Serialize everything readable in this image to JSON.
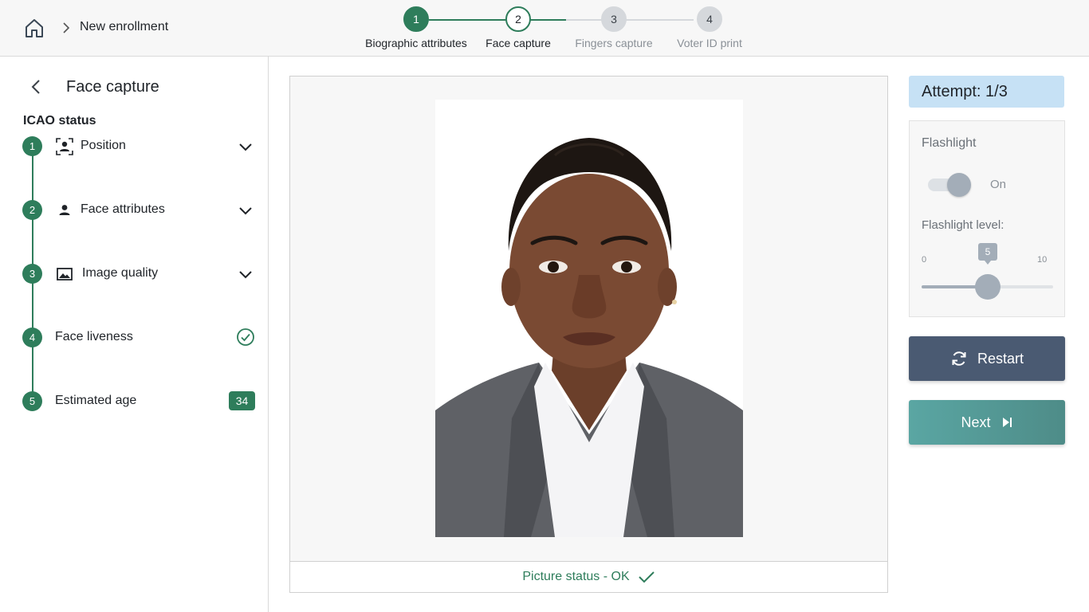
{
  "header": {
    "breadcrumb_title": "New enrollment",
    "steps": [
      {
        "number": "1",
        "label": "Biographic attributes",
        "state": "done"
      },
      {
        "number": "2",
        "label": "Face capture",
        "state": "active"
      },
      {
        "number": "3",
        "label": "Fingers capture",
        "state": "future"
      },
      {
        "number": "4",
        "label": "Voter ID print",
        "state": "future"
      }
    ]
  },
  "sidebar": {
    "title": "Face capture",
    "icao_label": "ICAO status",
    "items": [
      {
        "number": "1",
        "label": "Position",
        "icon": "person-frame-icon",
        "trailing": "chevron-down-icon"
      },
      {
        "number": "2",
        "label": "Face attributes",
        "icon": "person-icon",
        "trailing": "chevron-down-icon"
      },
      {
        "number": "3",
        "label": "Image quality",
        "icon": "image-icon",
        "trailing": "chevron-down-icon"
      },
      {
        "number": "4",
        "label": "Face liveness",
        "icon": "",
        "trailing": "check-circle-icon"
      },
      {
        "number": "5",
        "label": "Estimated age",
        "icon": "",
        "trailing": "age-badge",
        "badge": "34"
      }
    ]
  },
  "capture": {
    "status_text": "Picture status - OK"
  },
  "right_panel": {
    "attempt": "Attempt: 1/3",
    "flashlight_title": "Flashlight",
    "flashlight_state": "On",
    "flashlight_level_title": "Flashlight level:",
    "slider": {
      "min": "0",
      "max": "10",
      "value": "5",
      "fraction": 0.5
    },
    "restart_label": "Restart",
    "next_label": "Next"
  },
  "colors": {
    "accent_green": "#2e7d5b",
    "restart_bg": "#4a5a72",
    "next_bg": "#5aa6a3",
    "attempt_bg": "#c6e1f5"
  }
}
